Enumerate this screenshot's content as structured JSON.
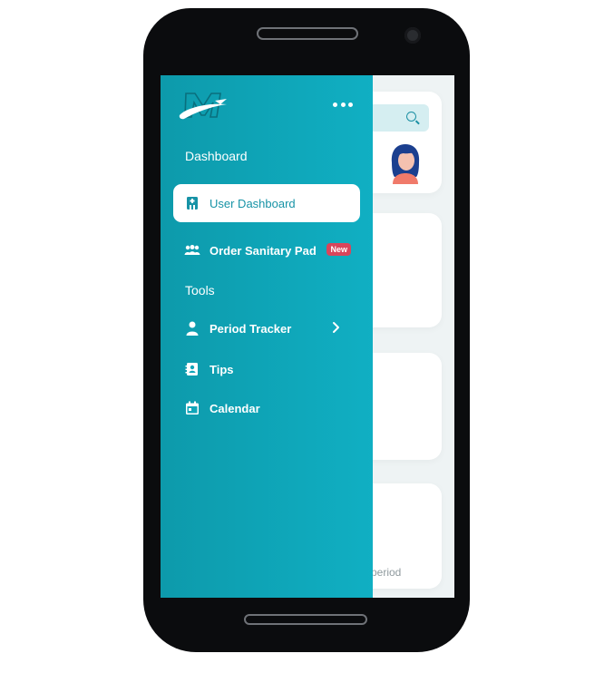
{
  "drawer": {
    "sections": {
      "main_title": "Dashboard",
      "tools_title": "Tools"
    },
    "items": [
      {
        "label": "User Dashboard",
        "icon": "hospital-badge-icon",
        "active": true
      },
      {
        "label": "Order Sanitary Pad",
        "icon": "group-icon",
        "badge": "New"
      },
      {
        "label": "Period Tracker",
        "icon": "person-icon",
        "has_submenu": true
      },
      {
        "label": "Tips",
        "icon": "contact-card-icon"
      },
      {
        "label": "Calendar",
        "icon": "calendar-icon"
      }
    ]
  },
  "background": {
    "partial_text": "period"
  },
  "colors": {
    "drawer_start": "#0d9aab",
    "drawer_end": "#10afc3",
    "active_text": "#1793a6",
    "badge": "#d9455b",
    "search_bg": "#d5eef1"
  }
}
